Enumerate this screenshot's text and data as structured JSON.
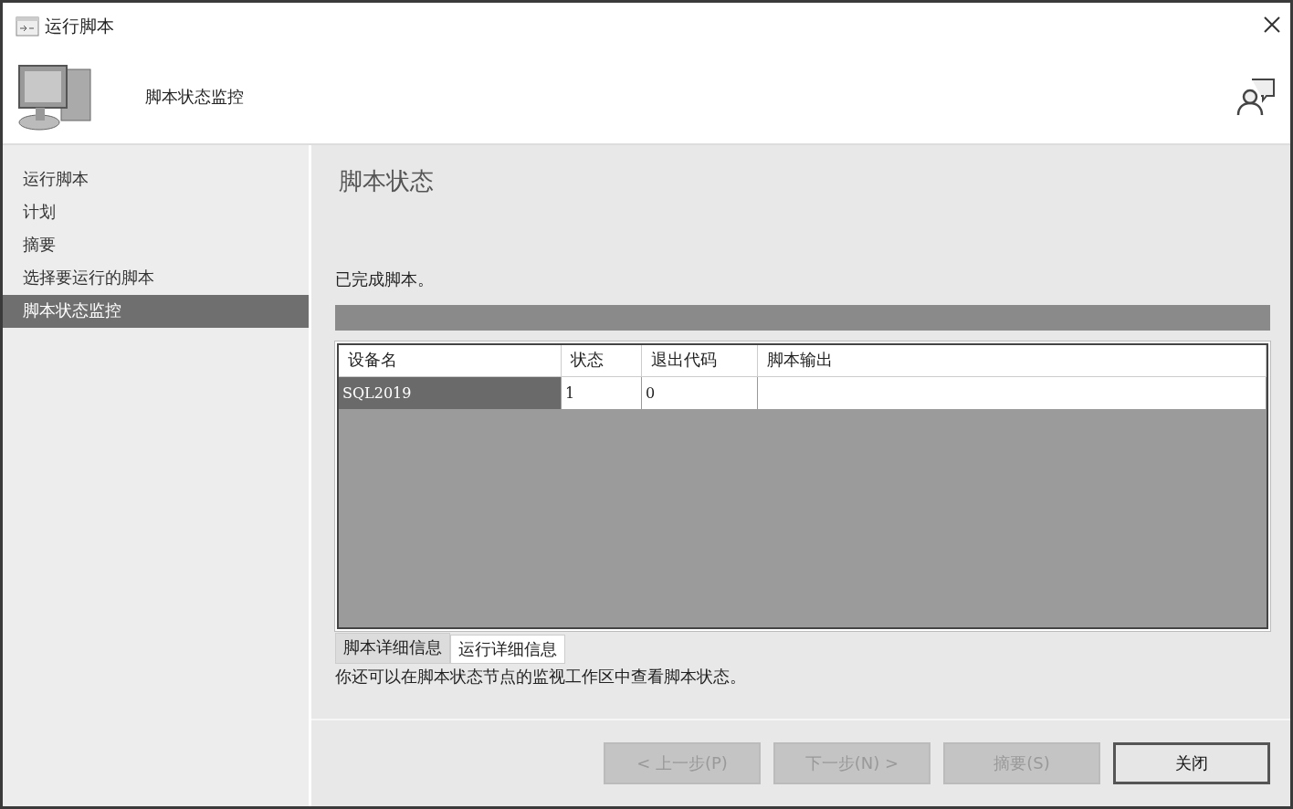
{
  "window": {
    "title": "运行脚本"
  },
  "header": {
    "title": "脚本状态监控"
  },
  "sidebar": {
    "items": [
      {
        "label": "运行脚本",
        "selected": false
      },
      {
        "label": "计划",
        "selected": false
      },
      {
        "label": "摘要",
        "selected": false
      },
      {
        "label": "选择要运行的脚本",
        "selected": false
      },
      {
        "label": "脚本状态监控",
        "selected": true
      }
    ]
  },
  "content": {
    "title": "脚本状态",
    "status_text": "已完成脚本。",
    "progress": {
      "level": 1
    },
    "table": {
      "columns": [
        "设备名",
        "状态",
        "退出代码",
        "脚本输出"
      ],
      "rows": [
        {
          "cells": [
            "SQL2019",
            "1",
            "0",
            ""
          ],
          "selected": true
        }
      ]
    },
    "tabs": [
      {
        "label": "脚本详细信息",
        "selected": false
      },
      {
        "label": "运行详细信息",
        "selected": true
      }
    ],
    "note": "你还可以在脚本状态节点的监视工作区中查看脚本状态。"
  },
  "buttons": [
    {
      "label": "< 上一步(P)",
      "disabled": true
    },
    {
      "label": "下一步(N) >",
      "disabled": true
    },
    {
      "label": "摘要(S)",
      "disabled": true
    },
    {
      "label": "关闭",
      "disabled": false
    }
  ]
}
